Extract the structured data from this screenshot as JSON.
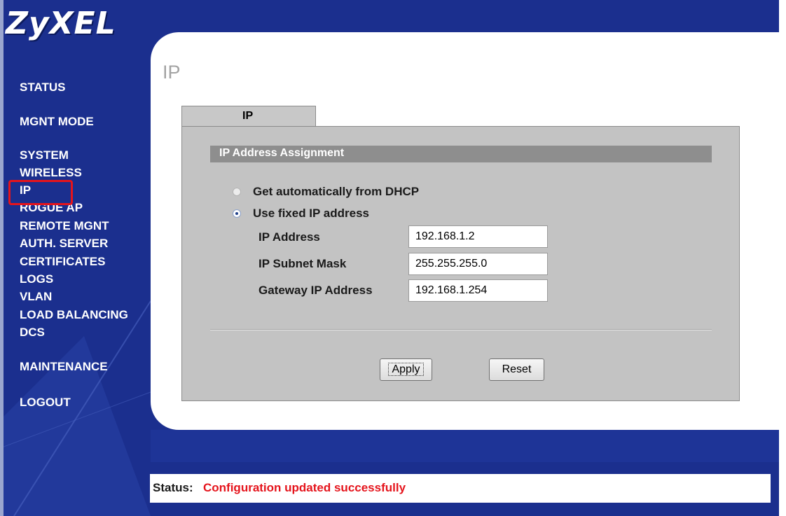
{
  "logo": "ZyXEL",
  "nav": {
    "status": "STATUS",
    "mgnt_mode": "MGNT MODE",
    "system": "SYSTEM",
    "wireless": "WIRELESS",
    "ip": "IP",
    "rogue_ap": "ROGUE AP",
    "remote_mgnt": "REMOTE MGNT",
    "auth_server": "AUTH. SERVER",
    "certificates": "CERTIFICATES",
    "logs": "LOGS",
    "vlan": "VLAN",
    "load_balancing": "LOAD BALANCING",
    "dcs": "DCS",
    "maintenance": "MAINTENANCE",
    "logout": "LOGOUT"
  },
  "page": {
    "title": "IP",
    "tab": "IP",
    "section": "IP Address Assignment"
  },
  "assignment": {
    "dhcp_label": "Get automatically from DHCP",
    "dhcp_checked": false,
    "fixed_label": "Use fixed IP address",
    "fixed_checked": true
  },
  "fields": {
    "ip_label": "IP Address",
    "ip_value": "192.168.1.2",
    "mask_label": "IP Subnet Mask",
    "mask_value": "255.255.255.0",
    "gateway_label": "Gateway IP Address",
    "gateway_value": "192.168.1.254"
  },
  "buttons": {
    "apply": "Apply",
    "reset": "Reset"
  },
  "status": {
    "label": "Status:",
    "message": "Configuration updated successfully"
  },
  "colors": {
    "background": "#1b2f8e",
    "highlight": "#e5141c",
    "status_message": "#e5141c"
  }
}
